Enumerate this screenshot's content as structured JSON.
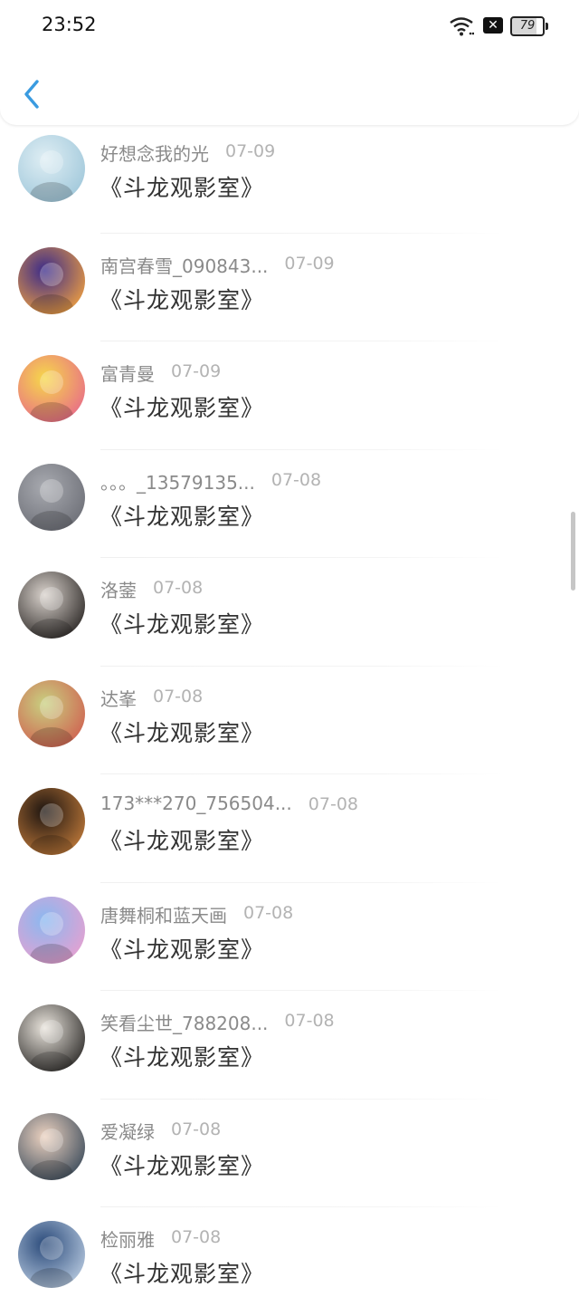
{
  "status_bar": {
    "time": "23:52",
    "battery": "79"
  },
  "header": {
    "back_icon": "chevron-left-icon"
  },
  "items": [
    {
      "name": "好想念我的光",
      "date": "07-09",
      "title": "《斗龙观影室》",
      "avatar_colors": [
        "#dfeef4",
        "#9fc7da"
      ]
    },
    {
      "name": "南宫春雪_090843...",
      "date": "07-09",
      "title": "《斗龙观影室》",
      "avatar_colors": [
        "#3a2a8a",
        "#f0a040"
      ]
    },
    {
      "name": "富青曼",
      "date": "07-09",
      "title": "《斗龙观影室》",
      "avatar_colors": [
        "#f6d84a",
        "#e86a8a"
      ]
    },
    {
      "name": "。。。_13579135...",
      "date": "07-08",
      "title": "《斗龙观影室》",
      "avatar_colors": [
        "#a8aab0",
        "#6c6e76"
      ]
    },
    {
      "name": "洛蓥",
      "date": "07-08",
      "title": "《斗龙观影室》",
      "avatar_colors": [
        "#d9d2cc",
        "#2a2624"
      ]
    },
    {
      "name": "达峯",
      "date": "07-08",
      "title": "《斗龙观影室》",
      "avatar_colors": [
        "#c8d080",
        "#d06050"
      ]
    },
    {
      "name": "173***270_756504...",
      "date": "07-08",
      "title": "《斗龙观影室》",
      "avatar_colors": [
        "#1c1410",
        "#c07a3a"
      ]
    },
    {
      "name": "唐舞桐和蓝天画",
      "date": "07-08",
      "title": "《斗龙观影室》",
      "avatar_colors": [
        "#8ab8f0",
        "#e8a0d0"
      ]
    },
    {
      "name": "笑看尘世_788208...",
      "date": "07-08",
      "title": "《斗龙观影室》",
      "avatar_colors": [
        "#e9e4dc",
        "#2c2a28"
      ]
    },
    {
      "name": "爱凝绿",
      "date": "07-08",
      "title": "《斗龙观影室》",
      "avatar_colors": [
        "#ecd2c0",
        "#3a4a5a"
      ]
    },
    {
      "name": "检丽雅",
      "date": "07-08",
      "title": "《斗龙观影室》",
      "avatar_colors": [
        "#2a4a7a",
        "#b8cae0"
      ]
    }
  ]
}
